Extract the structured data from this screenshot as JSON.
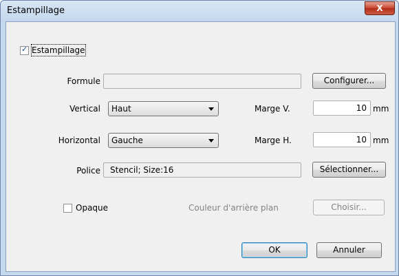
{
  "window": {
    "title": "Estampillage",
    "close_glyph": "X"
  },
  "stamp_checkbox": {
    "label": "Estampillage",
    "checked": true
  },
  "formula": {
    "label": "Formule",
    "value": "",
    "button": "Configurer..."
  },
  "vertical": {
    "label": "Vertical",
    "selected": "Haut"
  },
  "margin_v": {
    "label": "Marge V.",
    "value": "10",
    "unit": "mm"
  },
  "horizontal": {
    "label": "Horizontal",
    "selected": "Gauche"
  },
  "margin_h": {
    "label": "Marge H.",
    "value": "10",
    "unit": "mm"
  },
  "font": {
    "label": "Police",
    "value": "Stencil; Size:16",
    "button": "Sélectionner..."
  },
  "opaque": {
    "label": "Opaque",
    "checked": false
  },
  "background_color": {
    "label": "Couleur d'arrière plan",
    "button": "Choisir..."
  },
  "footer": {
    "ok": "OK",
    "cancel": "Annuler"
  }
}
